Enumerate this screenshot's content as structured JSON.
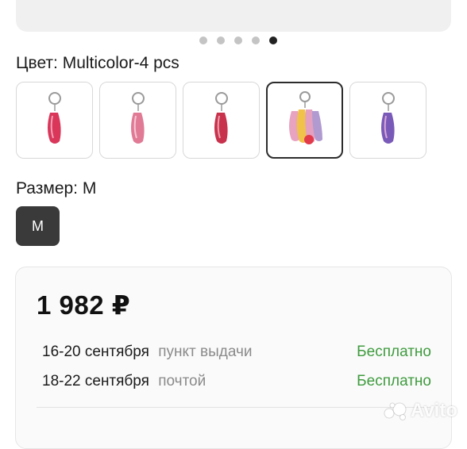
{
  "gallery": {
    "dot_count": 5,
    "active_dot": 4
  },
  "color": {
    "label": "Цвет: Multicolor-4 pcs",
    "selected_index": 3,
    "options": [
      {
        "icon": "pink-pointe-shoe-keychain",
        "color": "#d9365a"
      },
      {
        "icon": "pink-pointe-shoe-keychain",
        "color": "#e07a95"
      },
      {
        "icon": "pink-pointe-shoe-keychain",
        "color": "#c8324c"
      },
      {
        "icon": "multicolor-pointe-shoes-keychain",
        "color": "#e8a3c0"
      },
      {
        "icon": "purple-pointe-shoe-keychain",
        "color": "#7a5ab8"
      }
    ]
  },
  "size": {
    "label": "Размер: M",
    "selected": "M"
  },
  "offer": {
    "price": "1 982 ₽",
    "deliveries": [
      {
        "dates": "16-20 сентября",
        "method": "пункт выдачи",
        "cost": "Бесплатно"
      },
      {
        "dates": "18-22 сентября",
        "method": "почтой",
        "cost": "Бесплатно"
      }
    ]
  },
  "watermark": "Avito",
  "colors": {
    "accent_green": "#3f9b3f",
    "selected_border": "#2c2c2c",
    "size_button_bg": "#3a3a3a"
  }
}
